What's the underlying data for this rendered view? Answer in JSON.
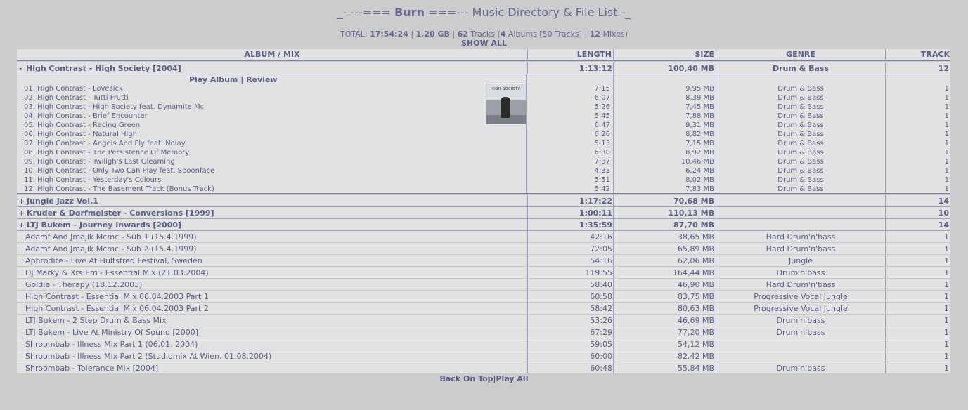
{
  "title": {
    "pre": "_- ---=== ",
    "name": "Burn",
    "post": " ===--- Music Directory & File List -_"
  },
  "totals": {
    "label": "TOTAL: ",
    "time": "17:54:24",
    "sep1": " | ",
    "size": "1,20 GB",
    "sep2": " | ",
    "tracks_count": "62",
    "tracks_word": " Tracks (",
    "albums_count": "4",
    "albums_word": " Albums [50 Tracks] | ",
    "mixes_count": "12",
    "mixes_word": " Mixes)"
  },
  "show_all": "SHOW ALL",
  "headers": {
    "album": "ALBUM / MIX",
    "length": "LENGTH",
    "size": "SIZE",
    "genre": "GENRE",
    "track": "TRACK"
  },
  "expanded_album": {
    "toggle": "-",
    "name": "High Contrast - High Society [2004]",
    "length": "1:13:12",
    "size": "100,40 MB",
    "genre": "Drum & Bass",
    "tracks": "12",
    "play_album": "Play Album",
    "link_sep": " | ",
    "review": "Review",
    "cover_text": "HIGH SOCIETY",
    "track_list": [
      {
        "name": "01. High Contrast - Lovesick",
        "length": "7:15",
        "size": "9,95 MB",
        "genre": "Drum & Bass",
        "track": "1"
      },
      {
        "name": "02. High Contrast - Tutti Frutti",
        "length": "6:07",
        "size": "8,39 MB",
        "genre": "Drum & Bass",
        "track": "1"
      },
      {
        "name": "03. High Contrast - High Society feat. Dynamite Mc",
        "length": "5:26",
        "size": "7,45 MB",
        "genre": "Drum & Bass",
        "track": "1"
      },
      {
        "name": "04. High Contrast - Brief Encounter",
        "length": "5:45",
        "size": "7,88 MB",
        "genre": "Drum & Bass",
        "track": "1"
      },
      {
        "name": "05. High Contrast - Racing Green",
        "length": "6:47",
        "size": "9,31 MB",
        "genre": "Drum & Bass",
        "track": "1"
      },
      {
        "name": "06. High Contrast - Natural High",
        "length": "6:26",
        "size": "8,82 MB",
        "genre": "Drum & Bass",
        "track": "1"
      },
      {
        "name": "07. High Contrast - Angels And Fly feat. Nolay",
        "length": "5:13",
        "size": "7,15 MB",
        "genre": "Drum & Bass",
        "track": "1"
      },
      {
        "name": "08. High Contrast - The Persistence Of Memory",
        "length": "6:30",
        "size": "8,92 MB",
        "genre": "Drum & Bass",
        "track": "1"
      },
      {
        "name": "09. High Contrast - Twiligh's Last Gleaming",
        "length": "7:37",
        "size": "10,46 MB",
        "genre": "Drum & Bass",
        "track": "1"
      },
      {
        "name": "10. High Contrast - Only Two Can Play feat. Spoonface",
        "length": "4:33",
        "size": "6,24 MB",
        "genre": "Drum & Bass",
        "track": "1"
      },
      {
        "name": "11. High Contrast - Yesterday's Colours",
        "length": "5:51",
        "size": "8,02 MB",
        "genre": "Drum & Bass",
        "track": "1"
      },
      {
        "name": "12. High Contrast - The Basement Track (Bonus Track)",
        "length": "5:42",
        "size": "7,83 MB",
        "genre": "Drum & Bass",
        "track": "1"
      }
    ]
  },
  "collapsed_albums": [
    {
      "toggle": "+",
      "name": "Jungle Jazz Vol.1",
      "length": "1:17:22",
      "size": "70,68 MB",
      "genre": "",
      "tracks": "14"
    },
    {
      "toggle": "+",
      "name": "Kruder & Dorfmeister - Conversions [1999]",
      "length": "1:00:11",
      "size": "110,13 MB",
      "genre": "",
      "tracks": "10"
    },
    {
      "toggle": "+",
      "name": "LTJ Bukem - Journey Inwards [2000]",
      "length": "1:35:59",
      "size": "87,70 MB",
      "genre": "",
      "tracks": "14"
    }
  ],
  "mixes": [
    {
      "name": "Adamf And Jmajik Mcmc - Sub 1 (15.4.1999)",
      "length": "42:16",
      "size": "38,65 MB",
      "genre": "Hard Drum'n'bass",
      "track": "1"
    },
    {
      "name": "Adamf And Jmajik Mcmc - Sub 2 (15.4.1999)",
      "length": "72:05",
      "size": "65,89 MB",
      "genre": "Hard Drum'n'bass",
      "track": "1"
    },
    {
      "name": "Aphrodite - Live At Hultsfred Festival, Sweden",
      "length": "54:16",
      "size": "62,06 MB",
      "genre": "Jungle",
      "track": "1"
    },
    {
      "name": "Dj Marky & Xrs Em - Essential Mix (21.03.2004)",
      "length": "119:55",
      "size": "164,44 MB",
      "genre": "Drum'n'bass",
      "track": "1"
    },
    {
      "name": "Goldie - Therapy (18.12.2003)",
      "length": "58:40",
      "size": "46,90 MB",
      "genre": "Hard Drum'n'bass",
      "track": "1"
    },
    {
      "name": "High Contrast - Essential Mix 06.04.2003 Part 1",
      "length": "60:58",
      "size": "83,75 MB",
      "genre": "Progressive Vocal Jungle",
      "track": "1"
    },
    {
      "name": "High Contrast - Essential Mix 06.04.2003 Part 2",
      "length": "58:42",
      "size": "80,63 MB",
      "genre": "Progressive Vocal Jungle",
      "track": "1"
    },
    {
      "name": "LTJ Bukem - 2 Step Drum & Bass Mix",
      "length": "53:26",
      "size": "46,69 MB",
      "genre": "Drum'n'bass",
      "track": "1"
    },
    {
      "name": "LTJ Bukem - Live At Ministry Of Sound [2000]",
      "length": "67:29",
      "size": "77,20 MB",
      "genre": "Drum'n'bass",
      "track": "1"
    },
    {
      "name": "Shroombab - Illness Mix Part 1 (06.01. 2004)",
      "length": "59:05",
      "size": "54,12 MB",
      "genre": "",
      "track": "1"
    },
    {
      "name": "Shroombab - Illness Mix Part 2 (Studiomix At Wien, 01.08.2004)",
      "length": "60:00",
      "size": "82,42 MB",
      "genre": "",
      "track": "1"
    },
    {
      "name": "Shroombab - Tolerance Mix [2004]",
      "length": "60:48",
      "size": "55,84 MB",
      "genre": "Drum'n'bass",
      "track": "1"
    }
  ],
  "footer": {
    "back": "Back On Top",
    "sep": "|",
    "play_all": "Play All"
  },
  "colors": {
    "background": "#cccccc",
    "row": "#e2e2e2",
    "text": "#5b5f88",
    "rule": "#7a7fa0"
  }
}
